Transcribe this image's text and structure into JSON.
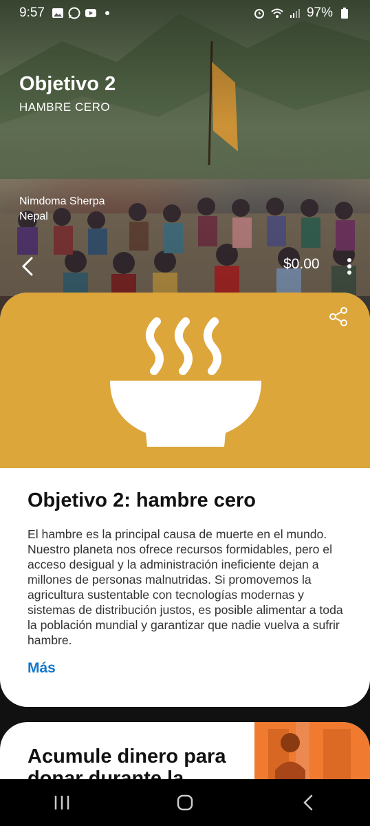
{
  "status_bar": {
    "time": "9:57",
    "battery": "97%",
    "icons": [
      "gallery-icon",
      "whatsapp-icon",
      "youtube-icon",
      "dot-icon",
      "alarm-icon",
      "wifi-icon",
      "signal-icon",
      "battery-icon"
    ]
  },
  "hero": {
    "title": "Objetivo 2",
    "subtitle": "HAMBRE CERO",
    "photo_credit_name": "Nimdoma Sherpa",
    "photo_credit_place": "Nepal",
    "donation_amount": "$0.00"
  },
  "goal_card": {
    "banner_color": "#DDA63A",
    "title": "Objetivo 2: hambre cero",
    "description": "El hambre es la principal causa de muerte en el mundo. Nuestro planeta nos ofrece recursos formidables, pero el acceso desigual y la administración ineficiente dejan a millones de personas malnutridas. Si promovemos la agricultura sustentable con tecnologías modernas y sistemas de distribución justos, es posible alimentar a toda la población mundial y garantizar que nadie vuelva a sufrir hambre.",
    "more_label": "Más"
  },
  "promo_card": {
    "title": "Acumule dinero para donar durante la",
    "accent_color": "#F07A30"
  },
  "nav_bar": {
    "buttons": [
      "recents-icon",
      "home-icon",
      "back-icon"
    ]
  }
}
